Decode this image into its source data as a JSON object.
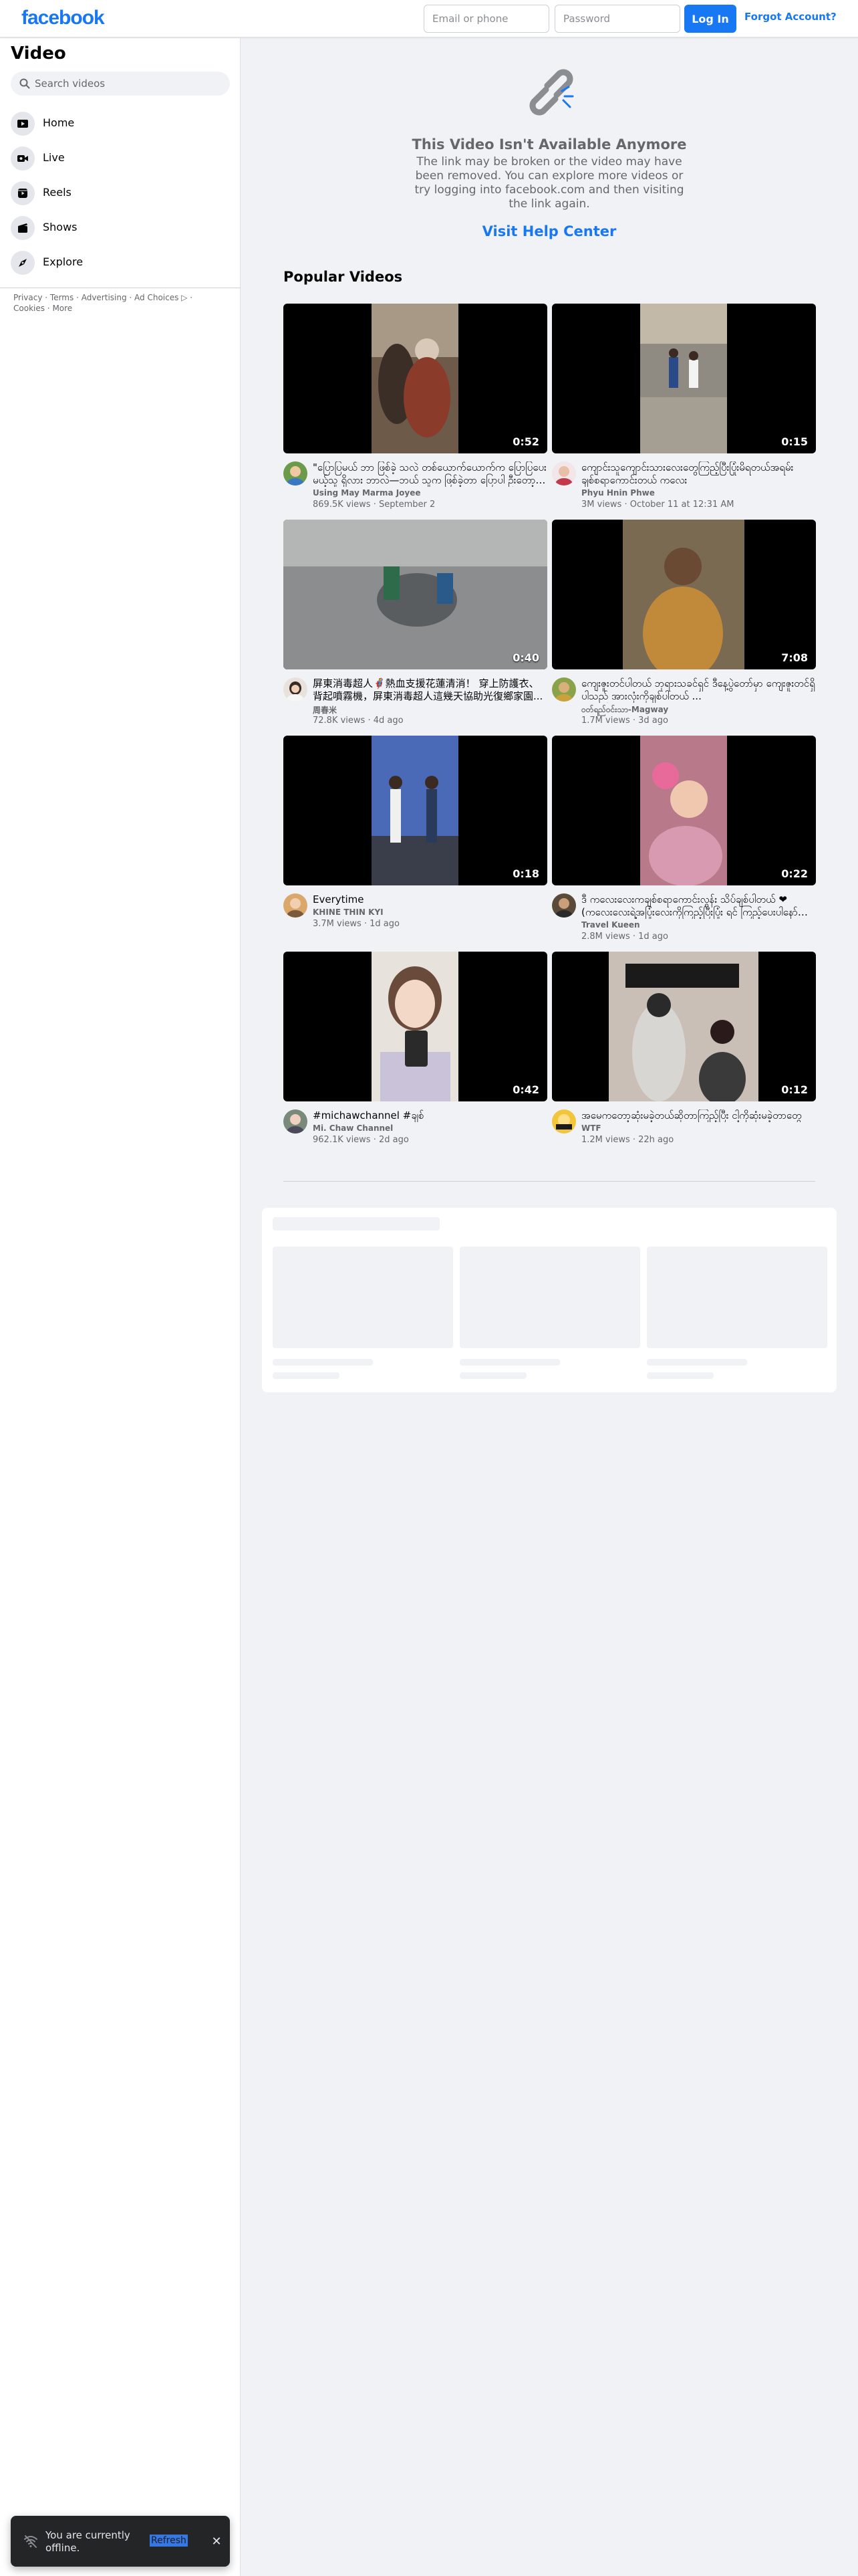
{
  "header": {
    "logo": "facebook",
    "email_placeholder": "Email or phone",
    "password_placeholder": "Password",
    "login_label": "Log In",
    "forgot_label": "Forgot Account?"
  },
  "sidebar": {
    "title": "Video",
    "search_placeholder": "Search videos",
    "items": [
      {
        "label": "Home",
        "icon": "home-video-icon"
      },
      {
        "label": "Live",
        "icon": "live-icon"
      },
      {
        "label": "Reels",
        "icon": "reels-icon"
      },
      {
        "label": "Shows",
        "icon": "shows-icon"
      },
      {
        "label": "Explore",
        "icon": "explore-icon"
      }
    ],
    "footer": [
      "Privacy",
      "Terms",
      "Advertising",
      "Ad Choices",
      "Cookies",
      "More"
    ]
  },
  "error": {
    "title": "This Video Isn't Available Anymore",
    "message": "The link may be broken or the video may have been removed. You can explore more videos or try logging into facebook.com and then visiting the link again.",
    "help_link": "Visit Help Center"
  },
  "popular": {
    "heading": "Popular Videos",
    "videos": [
      {
        "duration": "0:52",
        "title": "\"ပြောပြမယ် ဘာ ဖြစ်ခဲ့ သလဲ တစ်ယောက်ယောက်က ပြောပြပေးမယ့်သူ ရှိလား ဘာလဲ—ဘယ် သူက ဖြစ်ခဲ့တာ ပြောပါ ဦးတော့တော့...",
        "author": "Using May Marma Joyee",
        "meta": "869.5K views · September 2"
      },
      {
        "duration": "0:15",
        "title": "ကျောင်းသူကျောင်းသားလေးတွေကြည့်ပြီးပြုံးမိရတယ်အရမ်းချစ်စရာကောင်းတယ် ကလေး",
        "author": "Phyu Hnin Phwe",
        "meta": "3M views · October 11 at 12:31 AM"
      },
      {
        "duration": "0:40",
        "title": "屏東消毒超人🦸熱血支援花蓮清消！ 穿上防護衣、背起噴霧機，屏東消毒超人這幾天協助光復鄉家園...",
        "author": "周春米",
        "meta": "72.8K views · 4d ago"
      },
      {
        "duration": "7:08",
        "title": "ကျေးဇူးတင်ပါတယ် ဘုရားသခင်ရှင် ဒီနေ့ပွဲတော်မှာ ကျေးဇူးတင်ရှိပါသည် အားလုံးကိုချစ်ပါတယ် ...",
        "author": "ဝတ်ရည်ဝင်းသာ-Magway",
        "meta": "1.7M views · 3d ago"
      },
      {
        "duration": "0:18",
        "title": "Everytime",
        "author": "KHINE THIN KYI",
        "meta": "3.7M views · 1d ago"
      },
      {
        "duration": "0:22",
        "title": "ဒီ ကလေးလေးကချစ်စရာကောင်းလွန်း သိပ်ချစ်ပါတယ် ❤ (ကလေးလေးရဲ့အပြုံးလေးကိုကြည့်ပြီးပြုံး ရင် ကြည့်ပေးပါနော် 🙏)",
        "author": "Travel Kueen",
        "meta": "2.8M views · 1d ago"
      },
      {
        "duration": "0:42",
        "title": "#michawchannel #ချစ်",
        "author": "Mi. Chaw Channel",
        "meta": "962.1K views · 2d ago"
      },
      {
        "duration": "0:12",
        "title": "အမေကတော့ဆုံးမခဲ့တယ်ဆိုတာကြည့်ပြီး ငါ့ကိုဆုံးမခဲ့တာတွေ",
        "author": "WTF",
        "meta": "1.2M views · 22h ago"
      }
    ]
  },
  "toast": {
    "message": "You are currently offline.",
    "action": "Refresh"
  },
  "colors": {
    "brand": "#1877f2",
    "page_bg": "#f0f2f5",
    "secondary_text": "#65676b"
  }
}
